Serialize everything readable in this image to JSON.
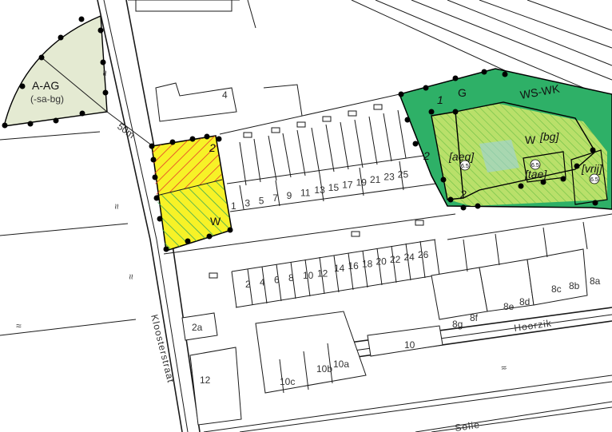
{
  "colors": {
    "agrarian": "#e4ead2",
    "residential_yellow": "#f7f227",
    "hatch_red": "#e53a2a",
    "hatch_green": "#3aa957",
    "green_zone": "#2eb067",
    "light_green": "#b9e06a",
    "boundary": "#000000"
  },
  "zones": {
    "agrarian": {
      "label": "A-AG",
      "sub": "(-sa-bg)"
    },
    "west_block": {
      "label": "W",
      "number": "2"
    },
    "east_block": {
      "green_label": "G",
      "green_number": "1",
      "ws_wk": "WS-WK",
      "w_label": "W",
      "w_sub": "[bg]",
      "aeg": "[aeg]",
      "tae": "[tae]",
      "vrij": "[vrij]",
      "num_2a": "2",
      "num_2b": "2",
      "height_a": "6.5",
      "height_b": "6.5",
      "height_c": "6.5"
    }
  },
  "measure": {
    "label": "50m"
  },
  "streets": {
    "kloosterstraat": "Kloosterstraat",
    "hoorzik": "Hoorzik",
    "solie": "Solie"
  },
  "house_numbers": {
    "n4": "4",
    "north_row": [
      "1",
      "3",
      "5",
      "7",
      "9",
      "11",
      "13",
      "15",
      "17",
      "19",
      "21",
      "23",
      "25"
    ],
    "middle_row_left": [
      "2",
      "4",
      "6",
      "8",
      "10",
      "12"
    ],
    "middle_row_right": [
      "14",
      "16",
      "18",
      "20",
      "22",
      "24",
      "26"
    ],
    "n2a": "2a",
    "n12": "12",
    "n10": "10",
    "n10a": "10a",
    "n10b": "10b",
    "n10c": "10c",
    "n8a": "8a",
    "n8b": "8b",
    "n8c": "8c",
    "n8d": "8d",
    "n8e": "8e",
    "n8f": "8f",
    "n8g": "8g"
  }
}
